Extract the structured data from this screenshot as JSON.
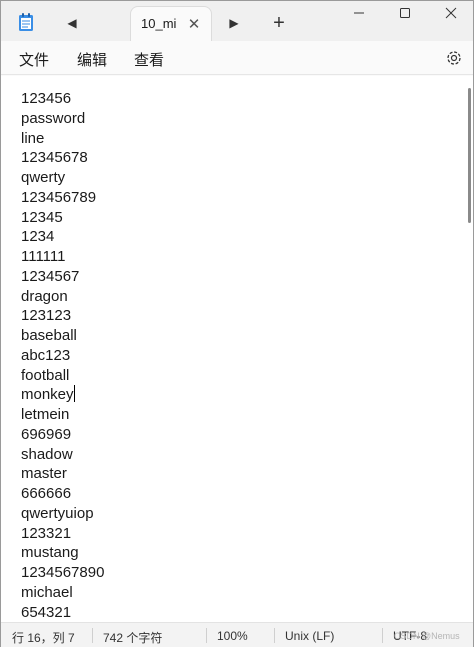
{
  "tab": {
    "title": "10_mi"
  },
  "menu": {
    "file": "文件",
    "edit": "编辑",
    "view": "查看"
  },
  "icons": {
    "app": "notepad-icon",
    "back": "caret-left-icon",
    "forward": "caret-right-icon",
    "new_tab": "plus-icon",
    "close_tab": "close-icon",
    "minimize": "minimize-icon",
    "maximize": "maximize-icon",
    "close_window": "close-icon",
    "settings": "gear-icon"
  },
  "editor": {
    "lines": [
      "123456",
      "password",
      "line",
      "12345678",
      "qwerty",
      "123456789",
      "12345",
      "1234",
      "111111",
      "1234567",
      "dragon",
      "123123",
      "baseball",
      "abc123",
      "football",
      "monkey",
      "letmein",
      "696969",
      "shadow",
      "master",
      "666666",
      "qwertyuiop",
      "123321",
      "mustang",
      "1234567890",
      "michael",
      "654321"
    ],
    "caret_line": 16
  },
  "status": {
    "position": "行 16，列 7",
    "chars": "742 个字符",
    "zoom": "100%",
    "line_ending": "Unix (LF)",
    "encoding": "UTF-8",
    "watermark": "CSDN @Nemus"
  },
  "colors": {
    "titlebar": "#f0f0f0",
    "editor_bg": "#ffffff",
    "statusbar": "#f3f3f3"
  }
}
